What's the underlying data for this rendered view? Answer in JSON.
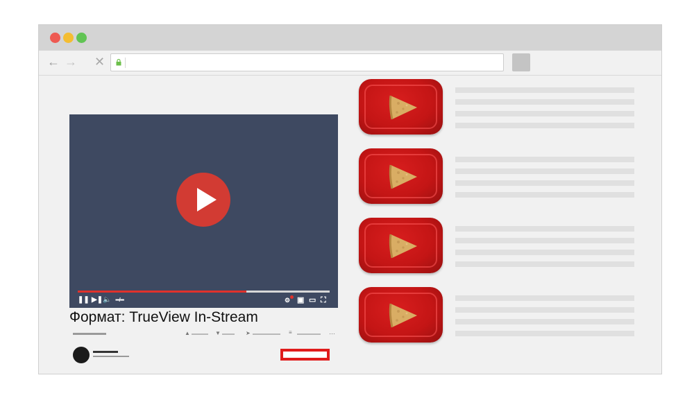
{
  "window": {
    "controls": {
      "close_color": "#ee5a52",
      "minimize_color": "#f4bd32",
      "zoom_color": "#61c454"
    }
  },
  "toolbar": {
    "back_icon": "arrow-left-icon",
    "forward_icon": "arrow-right-icon",
    "stop_icon": "close-icon",
    "secure_icon": "lock-icon",
    "url_value": "",
    "extension_icon": "extension-button"
  },
  "player": {
    "play_icon": "play-icon",
    "progress": 0.67,
    "time_display": "▪▪▪/▪▪▪",
    "accent_color": "#e0312b",
    "background_color": "#3e4961"
  },
  "video": {
    "title": "Формат: TrueView In-Stream"
  },
  "channel": {
    "avatar_icon": "avatar"
  },
  "related": {
    "items": [
      {
        "thumbnail": "pizza-on-red-tray"
      },
      {
        "thumbnail": "pizza-on-red-tray"
      },
      {
        "thumbnail": "pizza-on-red-tray"
      },
      {
        "thumbnail": "pizza-on-red-tray"
      }
    ]
  }
}
